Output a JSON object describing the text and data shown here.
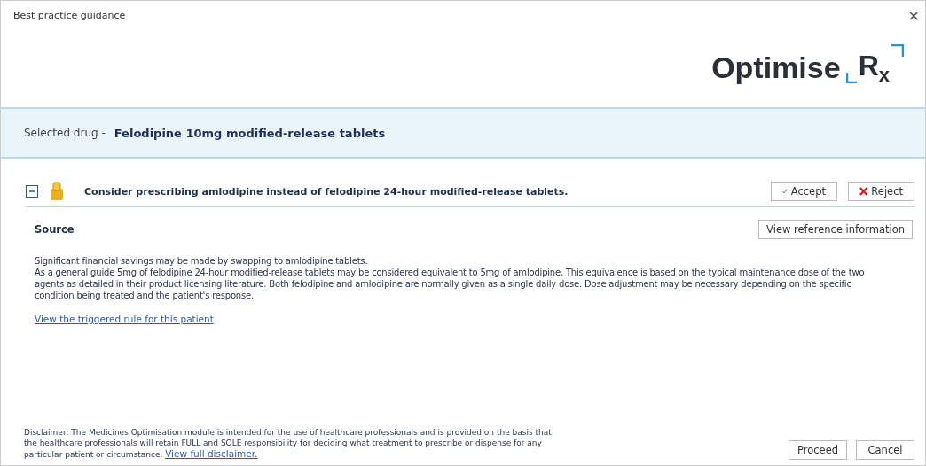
{
  "window": {
    "title": "Best practice guidance",
    "close": "×"
  },
  "logo": {
    "word": "Optimise",
    "mark": "R",
    "sub": "x"
  },
  "selected_drug": {
    "label": "Selected drug -",
    "value": "Felodipine 10mg modified-release tablets"
  },
  "recommendation": {
    "expanded": true,
    "text": "Consider prescribing amlodipine instead of felodipine 24-hour modified-release tablets.",
    "buttons": [
      {
        "kind": "accept",
        "label": "Accept"
      },
      {
        "kind": "reject",
        "label": "Reject"
      }
    ]
  },
  "source": {
    "heading": "Source",
    "button": "View reference information",
    "paragraphs": [
      "Significant financial savings may be made by swapping to amlodipine tablets.",
      "As a general guide 5mg of felodipine 24-hour modified-release tablets may be considered equivalent to 5mg of amlodipine. This equivalence is based on the typical maintenance dose of the two agents as detailed in their product licensing literature. Both felodipine and amlodipine are normally given as a single daily dose. Dose adjustment may be necessary depending on the specific condition being treated and the patient's response."
    ],
    "link": "View the triggered rule for this patient"
  },
  "disclaimer": {
    "text": "Disclaimer: The Medicines Optimisation module is intended for the use of healthcare professionals and is provided on the basis that the healthcare professionals will retain FULL and SOLE responsibility for deciding what treatment to prescribe or dispense for any particular patient or circumstance.",
    "link": "View full disclaimer."
  },
  "footer_buttons": [
    "Proceed",
    "Cancel"
  ]
}
